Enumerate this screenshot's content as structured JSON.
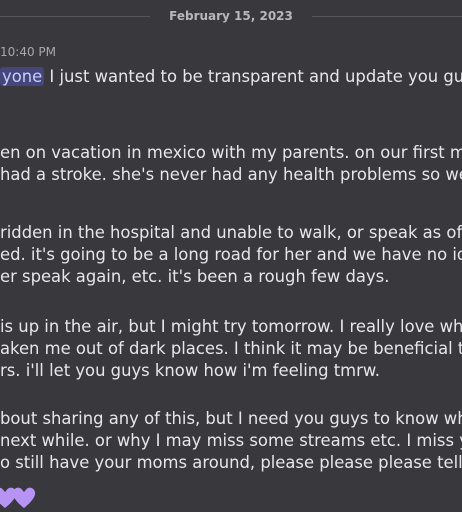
{
  "divider": {
    "date": "February 15, 2023"
  },
  "message": {
    "timestamp": "10:40 PM",
    "mention": "yone",
    "lines": [
      "I just wanted to be transparent and update you guys wit",
      "en on vacation in mexico with my parents. on our first mornin",
      "had a stroke. she's never had any health problems so we were",
      "ridden in the hospital and unable to walk, or speak as of right",
      "ed. it's going to be a long road for her and we have no idea how",
      "er speak again, etc. it's been a rough few days.",
      "is up in the air, but I might try tomorrow. I really love what I d",
      "aken me out of dark places. I think it may be beneficial to try t",
      "rs. i'll let you guys know how i'm feeling tmrw.",
      "bout sharing any of this, but I need you guys to know why I m",
      "next while. or why I may miss some streams etc. I miss you gu",
      "o still have your moms around, please please please tell them"
    ],
    "hearts": {
      "count": 2,
      "color": "#b794f4"
    }
  }
}
